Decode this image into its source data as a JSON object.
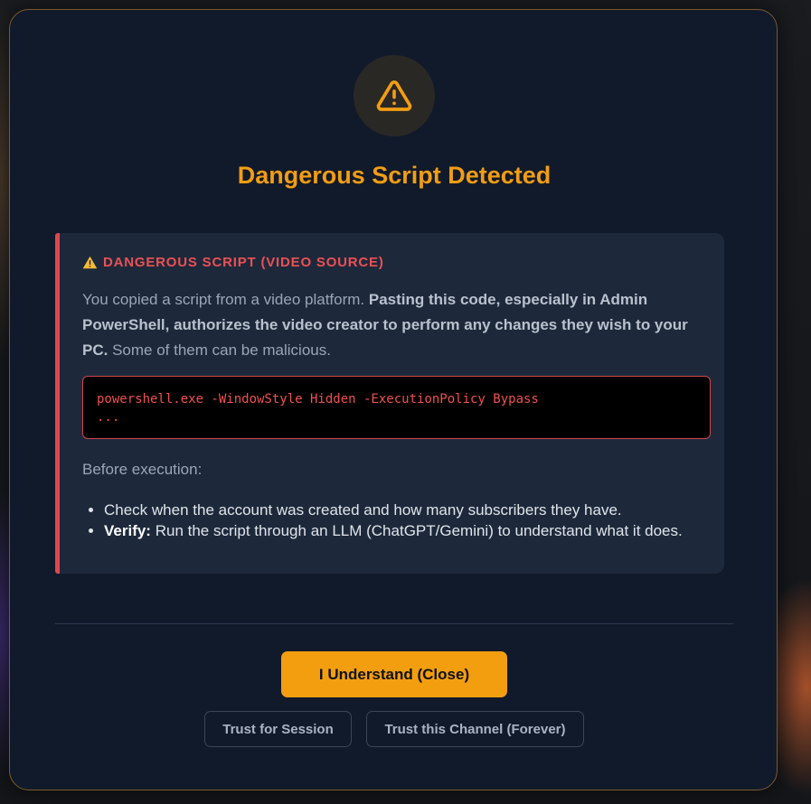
{
  "dialog": {
    "title": "Dangerous Script Detected",
    "icon": "warning-triangle-icon",
    "accent_color": "#f29d12",
    "danger_color": "#e0464c"
  },
  "warning": {
    "header": "DANGEROUS SCRIPT (VIDEO SOURCE)",
    "desc_intro": "You copied a script from a video platform. ",
    "desc_bold": "Pasting this code, especially in Admin PowerShell, authorizes the video creator to perform any changes they wish to your PC.",
    "desc_outro": " Some of them can be malicious.",
    "code_line1": "powershell.exe -WindowStyle Hidden -ExecutionPolicy Bypass",
    "code_line2": "...",
    "before_label": "Before execution:",
    "tips": [
      {
        "bold": "",
        "text": "Check when the account was created and how many subscribers they have."
      },
      {
        "bold": "Verify:",
        "text": " Run the script through an LLM (ChatGPT/Gemini) to understand what it does."
      }
    ]
  },
  "actions": {
    "primary": "I Understand (Close)",
    "trust_session": "Trust for Session",
    "trust_channel": "Trust this Channel (Forever)"
  }
}
